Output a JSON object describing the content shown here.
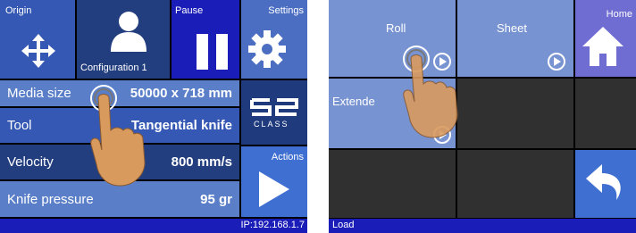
{
  "left_screen": {
    "origin_label": "Origin",
    "config_label": "Configuration 1",
    "pause_label": "Pause",
    "settings_label": "Settings",
    "rows": [
      {
        "label": "Media size",
        "value": "50000 x 718 mm"
      },
      {
        "label": "Tool",
        "value": "Tangential knife"
      },
      {
        "label": "Velocity",
        "value": "800 mm/s"
      },
      {
        "label": "Knife pressure",
        "value": "95 gr"
      }
    ],
    "logo_text": "CLASS",
    "actions_label": "Actions",
    "ip": "IP:192.168.1.7"
  },
  "right_screen": {
    "roll_label": "Roll",
    "sheet_label": "Sheet",
    "home_label": "Home",
    "extended_label": "Extende",
    "status_text": "Load"
  },
  "colors": {
    "dark_blue": "#233e7f",
    "mid_blue": "#3558b4",
    "light_blue": "#5a7fc8",
    "status_blue": "#1a1db8",
    "empty_tile": "#303030",
    "hand": "#d99a5e"
  },
  "icons": [
    "move-arrows-icon",
    "user-icon",
    "pause-icon",
    "gear-icon",
    "play-icon",
    "home-icon",
    "back-arrow-icon",
    "hand-pointer-icon"
  ]
}
